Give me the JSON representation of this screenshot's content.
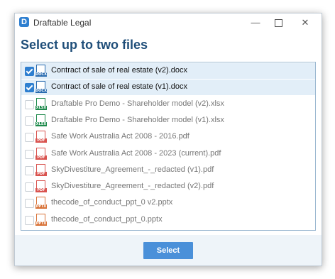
{
  "window": {
    "title": "Draftable Legal"
  },
  "heading": "Select up to two files",
  "files": [
    {
      "name": "Contract of sale of real estate (v2).docx",
      "type": "DOCX",
      "checked": true,
      "color": "#2b6cb0"
    },
    {
      "name": "Contract of sale of real estate (v1).docx",
      "type": "DOCX",
      "checked": true,
      "color": "#2b6cb0"
    },
    {
      "name": "Draftable Pro Demo - Shareholder model (v2).xlsx",
      "type": "XLSX",
      "checked": false,
      "color": "#1e8a4c"
    },
    {
      "name": "Draftable Pro Demo - Shareholder model (v1).xlsx",
      "type": "XLSX",
      "checked": false,
      "color": "#1e8a4c"
    },
    {
      "name": "Safe Work Australia Act 2008 - 2016.pdf",
      "type": "PDF",
      "checked": false,
      "color": "#d9534f"
    },
    {
      "name": "Safe Work Australia Act 2008 - 2023 (current).pdf",
      "type": "PDF",
      "checked": false,
      "color": "#d9534f"
    },
    {
      "name": "SkyDivestiture_Agreement_-_redacted (v1).pdf",
      "type": "PDF",
      "checked": false,
      "color": "#d9534f"
    },
    {
      "name": "SkyDivestiture_Agreement_-_redacted (v2).pdf",
      "type": "PDF",
      "checked": false,
      "color": "#d9534f"
    },
    {
      "name": "thecode_of_conduct_ppt_0 v2.pptx",
      "type": "PPTX",
      "checked": false,
      "color": "#d9743a"
    },
    {
      "name": "thecode_of_conduct_ppt_0.pptx",
      "type": "PPTX",
      "checked": false,
      "color": "#d9743a"
    }
  ],
  "footer": {
    "select_label": "Select"
  },
  "colors": {
    "accent": "#2e7fd0",
    "heading": "#1f4e79",
    "selected_row": "#e2eef8"
  },
  "icons": {
    "app": "draftable-logo-icon",
    "minimize": "minimize-icon",
    "maximize": "maximize-icon",
    "close": "close-icon"
  }
}
